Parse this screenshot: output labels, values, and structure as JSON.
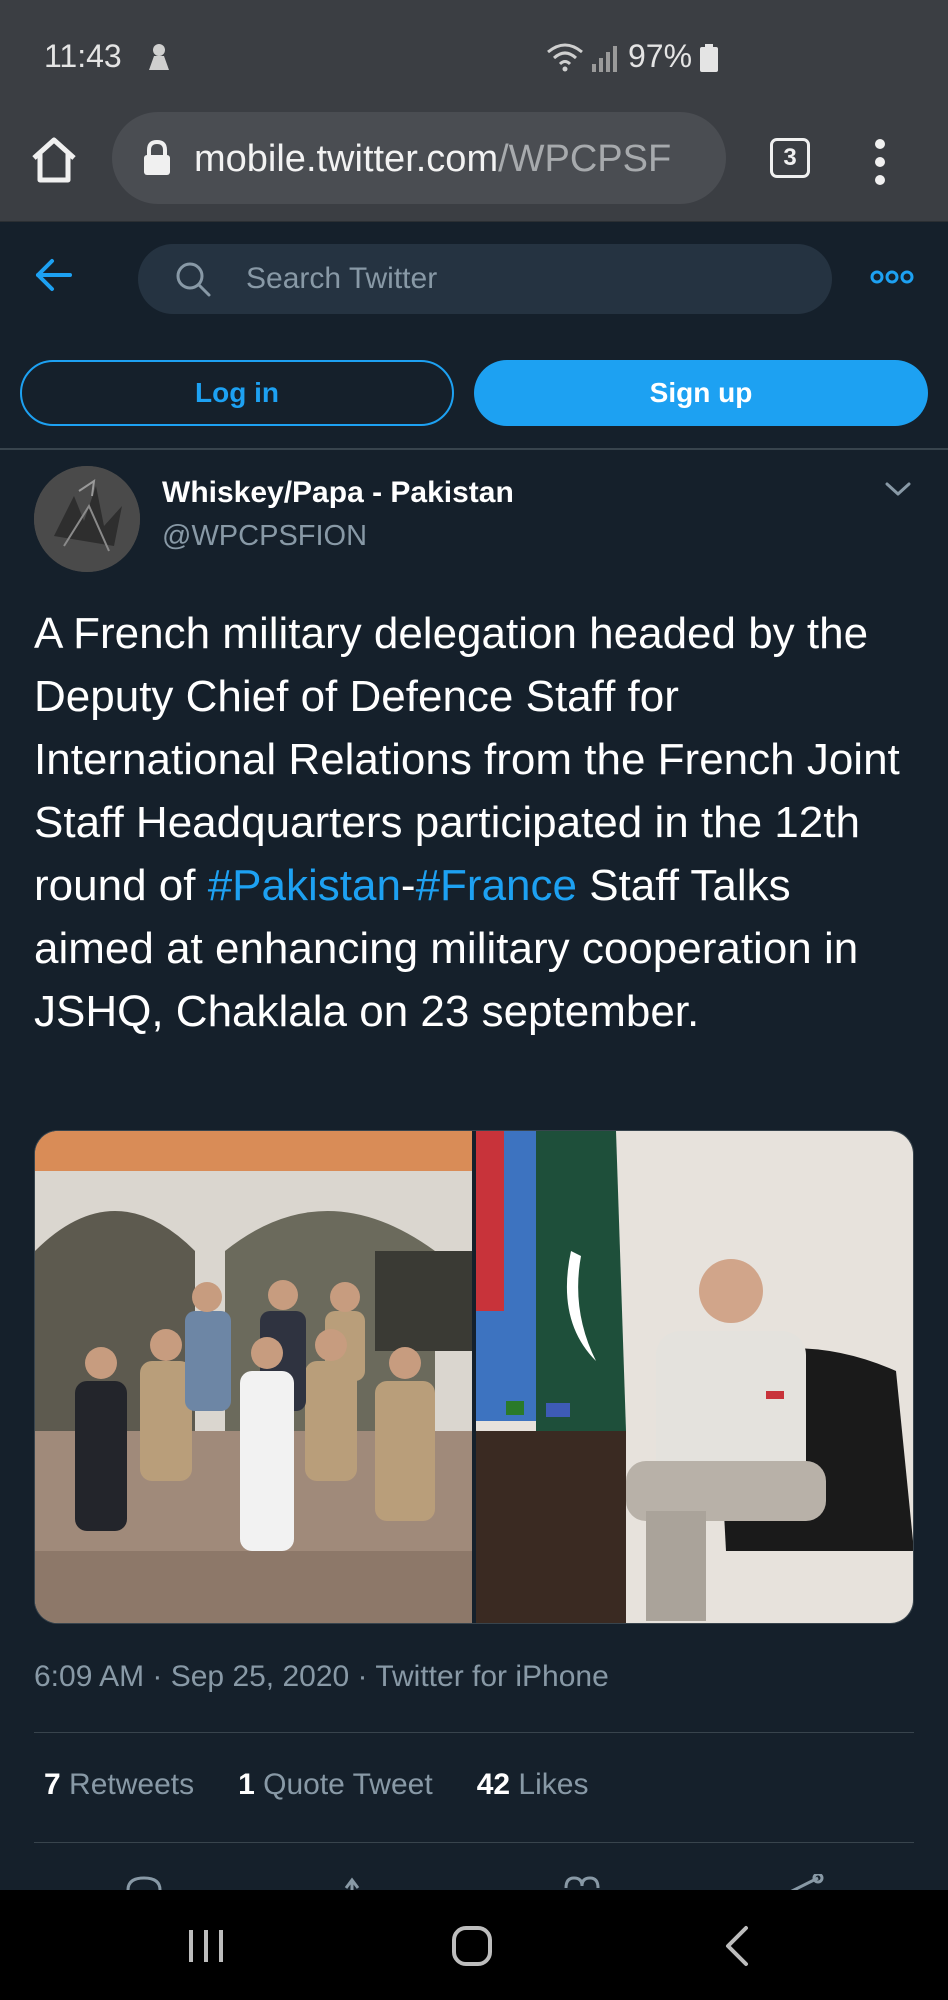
{
  "status_bar": {
    "time": "11:43",
    "battery": "97%"
  },
  "browser": {
    "url_host": "mobile.twitter.com",
    "url_path": "/WPCPSF",
    "tab_count": "3"
  },
  "twitter_header": {
    "search_placeholder": "Search Twitter",
    "login_label": "Log in",
    "signup_label": "Sign up"
  },
  "tweet": {
    "display_name": "Whiskey/Papa - Pakistan",
    "handle": "@WPCPSFION",
    "text_part1": "A French military delegation headed by the Deputy Chief of Defence Staff for International Relations from the French Joint Staff Headquarters participated in the 12th round of ",
    "hashtag1": "#Pakistan",
    "separator": "-",
    "hashtag2": "#France",
    "text_part2": " Staff Talks aimed at enhancing military cooperation in JSHQ, Chaklala on 23 september.",
    "timestamp": "6:09 AM · Sep 25, 2020 · Twitter for iPhone",
    "stats": {
      "retweets_count": "7",
      "retweets_label": "Retweets",
      "quotes_count": "1",
      "quotes_label": "Quote Tweet",
      "likes_count": "42",
      "likes_label": "Likes"
    }
  },
  "colors": {
    "background": "#15202b",
    "accent": "#1da1f2",
    "secondary_text": "#8899a6"
  }
}
